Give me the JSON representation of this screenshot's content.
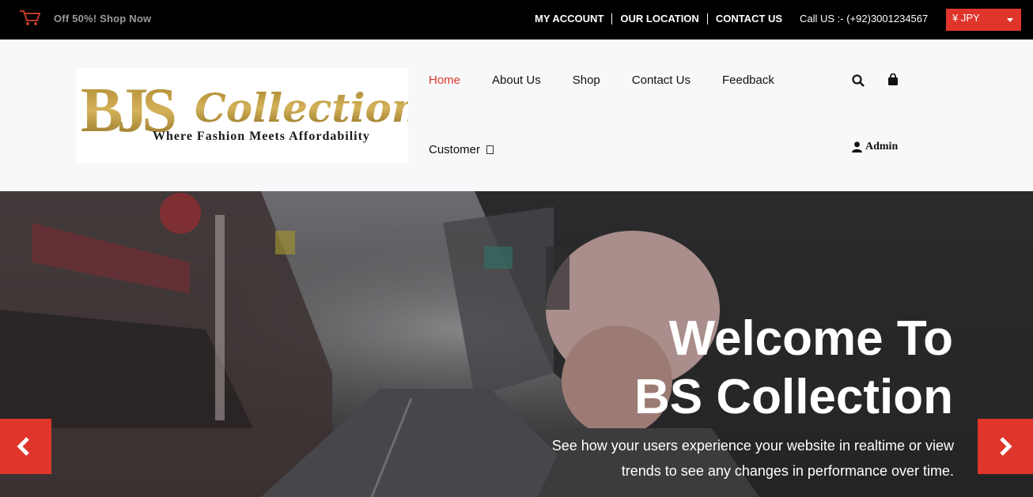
{
  "topbar": {
    "promo_icon": "cart-icon",
    "promo_text": "Off 50%! Shop Now",
    "links": [
      "MY ACCOUNT",
      "OUR LOCATION",
      "CONTACT US"
    ],
    "phone": "Call US :- (+92)3001234567",
    "currency": "¥ JPY"
  },
  "logo": {
    "initials": "BJS",
    "word": "Collection",
    "tagline": "Where Fashion Meets Affordability"
  },
  "nav": {
    "items": [
      "Home",
      "About Us",
      "Shop",
      "Contact Us",
      "Feedback"
    ],
    "active": "Home",
    "customer": "Customer",
    "admin": "Admin"
  },
  "hero": {
    "title_line1": "Welcome To",
    "title_line2": "BS Collection",
    "subtitle_line1": "See how your users experience your website in realtime or view",
    "subtitle_line2": "trends to see any changes in performance over time."
  },
  "colors": {
    "accent": "#e0352b",
    "topbar_bg": "#000000",
    "header_bg": "#f7f8fa",
    "logo_gold": "#b8912f"
  }
}
